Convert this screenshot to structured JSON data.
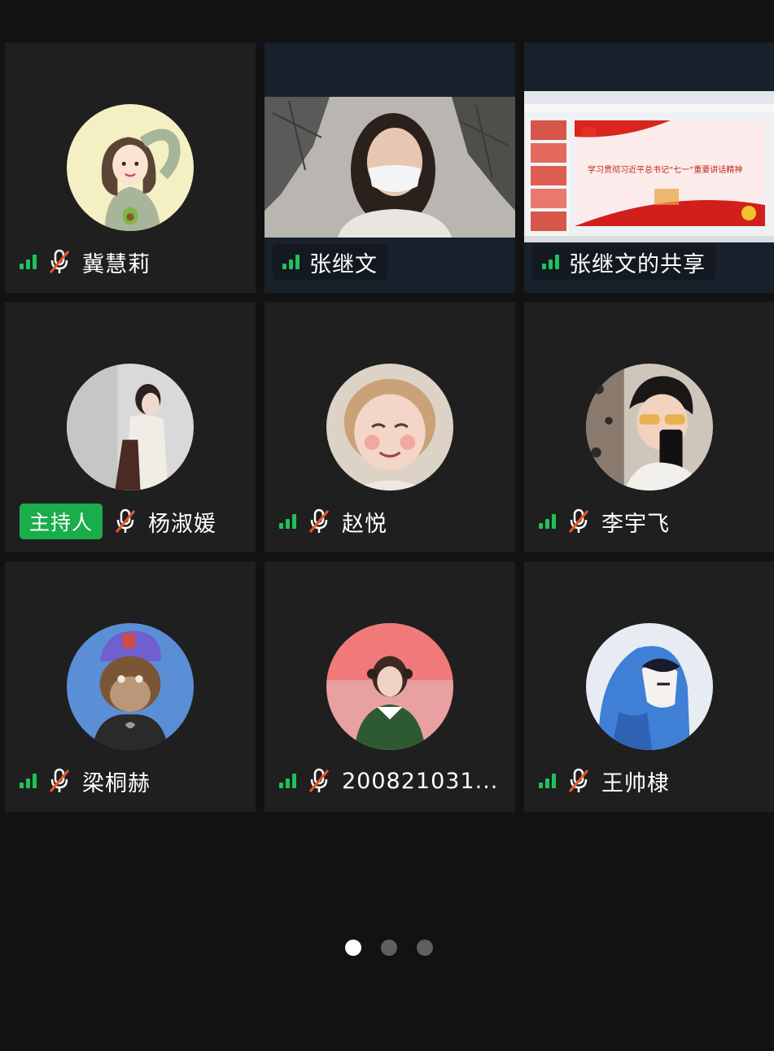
{
  "participants": [
    {
      "name": "冀慧莉",
      "muted": true
    },
    {
      "name": "张继文",
      "muted": false
    },
    {
      "name": "张继文的共享",
      "muted": false
    },
    {
      "name": "杨淑媛",
      "muted": true,
      "host_label": "主持人"
    },
    {
      "name": "赵悦",
      "muted": true
    },
    {
      "name": "李宇飞",
      "muted": true
    },
    {
      "name": "梁桐赫",
      "muted": true
    },
    {
      "name": "200821031...",
      "muted": true
    },
    {
      "name": "王帅棣",
      "muted": true
    }
  ],
  "shared_screen": {
    "slide_title": "学习贯彻习近平总书记“七一”重要讲话精神"
  },
  "pagination": {
    "pages": 3,
    "current": 1
  },
  "colors": {
    "background": "#121212",
    "tile": "#1f1f1f",
    "signal": "#1fc25a",
    "mute_slash": "#e8562a",
    "host_badge": "#1aad4c"
  }
}
